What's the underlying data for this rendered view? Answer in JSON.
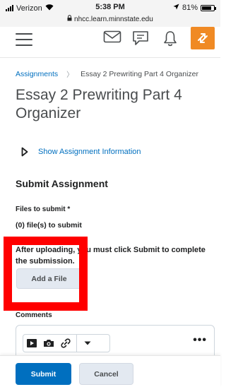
{
  "status_bar": {
    "carrier": "Verizon",
    "time": "5:38 PM",
    "url": "nhcc.learn.minnstate.edu",
    "battery": "81%",
    "battery_level": 0.81,
    "icons": [
      "signal-icon",
      "wifi-icon",
      "lock-icon",
      "location-arrow-icon",
      "battery-icon"
    ]
  },
  "nav": {
    "icons": [
      "hamburger-menu-icon",
      "mail-icon",
      "chat-icon",
      "bell-icon",
      "brand-icon"
    ],
    "brand_color": "#f08a24"
  },
  "breadcrumb": {
    "parent": "Assignments",
    "separator": "〉",
    "current": "Essay 2 Prewriting Part 4 Organizer"
  },
  "page_title": "Essay 2 Prewriting Part 4 Organizer",
  "show_info": {
    "label": "Show Assignment Information"
  },
  "submit_section": {
    "heading": "Submit Assignment",
    "files_label": "Files to submit *",
    "files_count": "(0) file(s) to submit",
    "instructions": "After uploading, you must click Submit to complete the submission.",
    "add_file_label": "Add a File"
  },
  "comments": {
    "label": "Comments",
    "toolbar_icons": [
      "video-icon",
      "camera-icon",
      "link-icon",
      "chevron-down-icon"
    ],
    "more_label": "•••"
  },
  "footer": {
    "submit_label": "Submit",
    "cancel_label": "Cancel"
  },
  "colors": {
    "link": "#006fbf",
    "primary_button": "#006fbf",
    "secondary_button": "#e3e9f1",
    "annotation_box": "#ff0000",
    "text_dark": "#202122",
    "text_muted": "#494c4e"
  }
}
